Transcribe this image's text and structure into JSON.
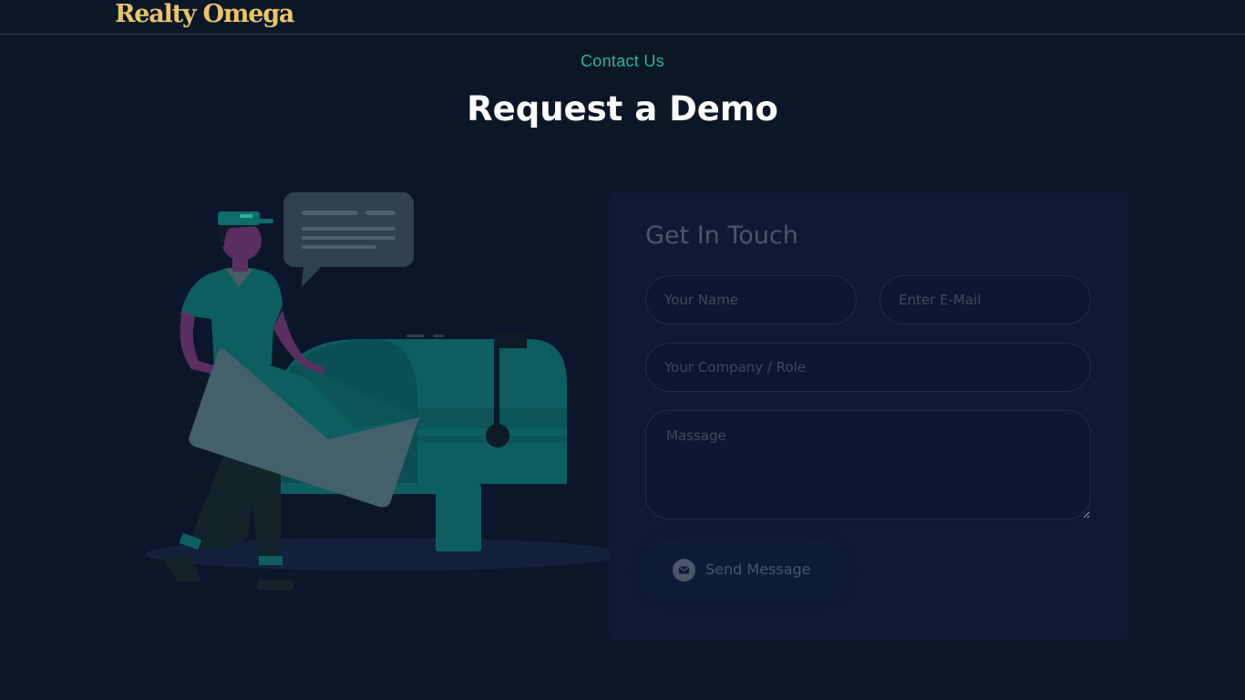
{
  "header": {
    "logo_text": "Realty Omega"
  },
  "hero": {
    "kicker": "Contact Us",
    "title": "Request a Demo"
  },
  "form": {
    "title": "Get In Touch",
    "name_placeholder": "Your Name",
    "email_placeholder": "Enter E-Mail",
    "company_placeholder": "Your Company / Role",
    "message_placeholder": "Massage",
    "send_label": "Send Message",
    "send_icon": "envelope-icon"
  },
  "colors": {
    "background": "#0b1629",
    "logo": "#e9c46a",
    "accent": "#2bb596",
    "card": "#0e1a33"
  },
  "illustration": {
    "subject": "mail-carrier-with-envelope-and-mailbox"
  }
}
